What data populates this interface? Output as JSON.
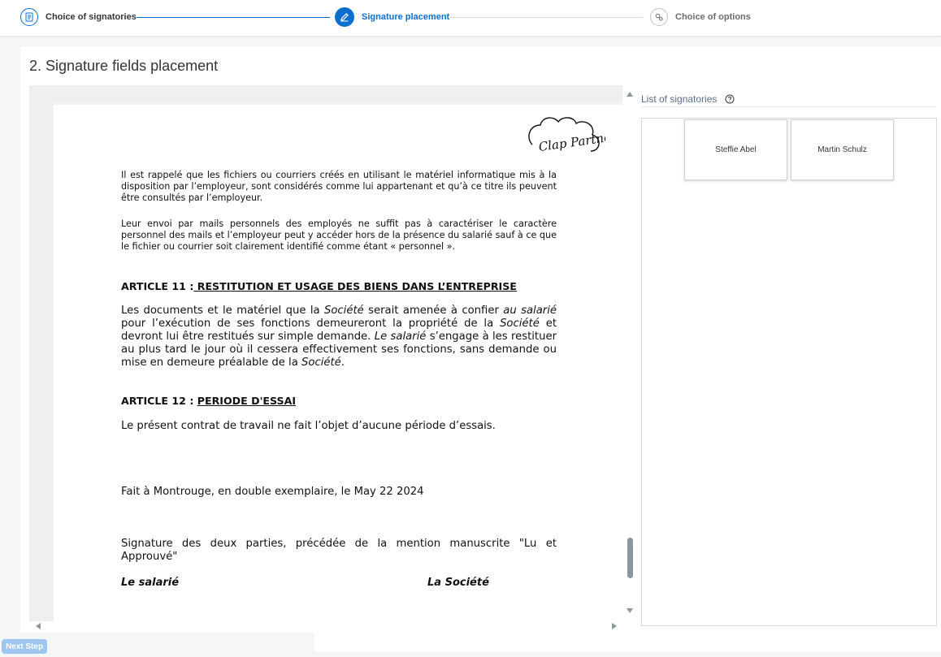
{
  "wizard": {
    "steps": [
      {
        "label": "Choice of signatories",
        "icon": "document-icon",
        "state": "completed"
      },
      {
        "label": "Signature placement",
        "icon": "pencil-icon",
        "state": "active"
      },
      {
        "label": "Choice of options",
        "icon": "settings-icon",
        "state": "pending"
      }
    ]
  },
  "main": {
    "title": "2. Signature fields placement"
  },
  "document": {
    "logo_text": "Clap Partners",
    "para1": "Il est rappelé que les fichiers ou courriers créés en utilisant le matériel informatique mis à la disposition par l’employeur, sont considérés comme lui appartenant et qu’à ce titre ils peuvent être consultés par l’employeur.",
    "para2": "Leur envoi par mails personnels des employés ne suffit pas à caractériser le caractère personnel des mails et l’employeur peut y accéder hors de la présence du salarié sauf à ce que le fichier ou courrier soit clairement identifié comme étant « personnel ».",
    "art11_prefix": "ARTICLE 11 :",
    "art11_title": " RESTITUTION ET USAGE DES BIENS DANS L’ENTREPRISE",
    "art11_body": {
      "t1": "Les documents et le matériel que la ",
      "i1": "Société",
      "t2": " serait amenée à confier ",
      "i2": "au salarié",
      "t3": " pour l’exécution de ses fonctions demeureront la propriété de la ",
      "i3": "Société",
      "t4": " et devront lui être restitués sur simple demande. ",
      "i4": "Le salarié",
      "t5": " s’engage à les restituer au plus tard le jour où il cessera effectivement ses fonctions, sans demande ou mise en demeure préalable de la ",
      "i5": "Société",
      "t6": "."
    },
    "art12_prefix": "ARTICLE 12 :",
    "art12_title": "PERIODE D'ESSAI",
    "art12_body": "Le présent contrat de travail ne fait l’objet d’aucune période d’essais.",
    "place_date": "Fait à Montrouge, en double exemplaire, le May 22 2024",
    "signature_note": "Signature des deux parties, précédée de la mention manuscrite \"Lu et Approuvé\"",
    "party_employee": "Le salarié",
    "party_company": "La Société"
  },
  "signatories": {
    "header": "List of signatories",
    "items": [
      "Steffie Abel",
      "Martin Schulz"
    ]
  },
  "footer": {
    "next_label": "Next Step"
  },
  "colors": {
    "accent": "#0a6ed1",
    "disabled_button": "#9ec6ee",
    "panel_bg": "#ffffff",
    "page_bg": "#f5f6f7"
  }
}
